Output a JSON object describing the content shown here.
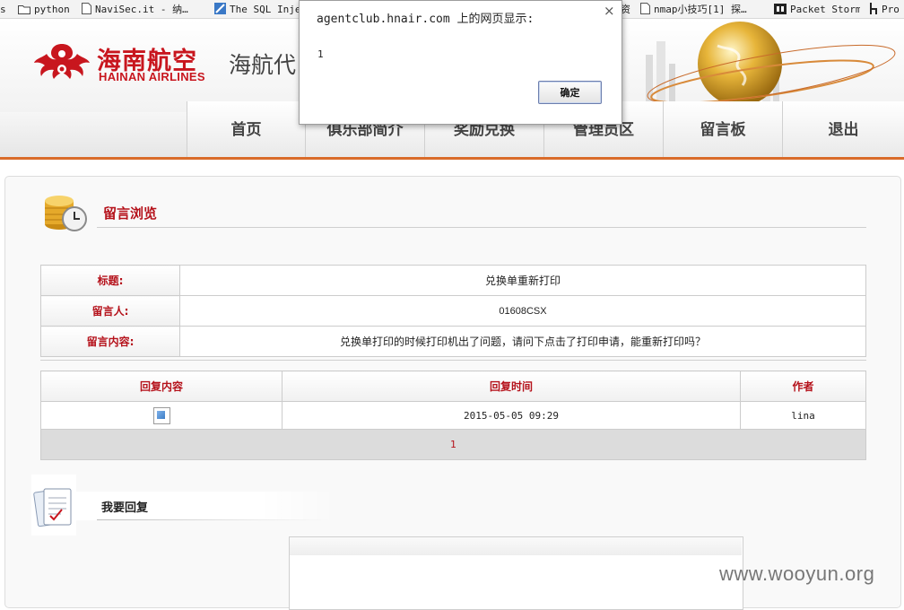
{
  "bookmarks": [
    {
      "label": "s",
      "icon": "none"
    },
    {
      "label": "python",
      "icon": "folder-icon"
    },
    {
      "label": "NaviSec.it - 纳…",
      "icon": "page-icon"
    },
    {
      "label": "The SQL Inje",
      "icon": "site-icon"
    },
    {
      "label": "资",
      "icon": "none"
    },
    {
      "label": "nmap小技巧[1] 探…",
      "icon": "page-icon"
    },
    {
      "label": "Packet Storm",
      "icon": "packetstorm-icon"
    },
    {
      "label": "Pro",
      "icon": "h-icon"
    }
  ],
  "header": {
    "brand_cn": "海南航空",
    "brand_en": "HAINAN AIRLINES",
    "agent_title": "海航代"
  },
  "nav": [
    {
      "label": "首页",
      "width": 132
    },
    {
      "label": "俱乐部简介",
      "width": 133
    },
    {
      "label": "奖励兑换",
      "width": 133
    },
    {
      "label": "管理员区",
      "width": 133
    },
    {
      "label": "留言板",
      "width": 133
    },
    {
      "label": "退出",
      "width": 136
    }
  ],
  "section": {
    "title": "留言浏览"
  },
  "message": {
    "subject_label": "标题:",
    "subject": "兑换单重新打印",
    "author_label": "留言人:",
    "author": "01608CSX",
    "content_label": "留言内容:",
    "content": "兑换单打印的时候打印机出了问题，请问下点击了打印申请，能重新打印吗？"
  },
  "replies": {
    "headers": [
      "回复内容",
      "回复时间",
      "作者"
    ],
    "rows": [
      {
        "content": "",
        "time": "2015-05-05 09:29",
        "author": "lina"
      }
    ],
    "page": "1"
  },
  "reply_form": {
    "title": "我要回复"
  },
  "dialog": {
    "title": "agentclub.hnair.com 上的网页显示:",
    "message": "1",
    "ok_label": "确定",
    "close_label": "×"
  },
  "watermark": "www.wooyun.org",
  "colors": {
    "brand_red": "#c8161e",
    "label_red": "#b5121b",
    "accent_orange": "#d96c2a"
  }
}
